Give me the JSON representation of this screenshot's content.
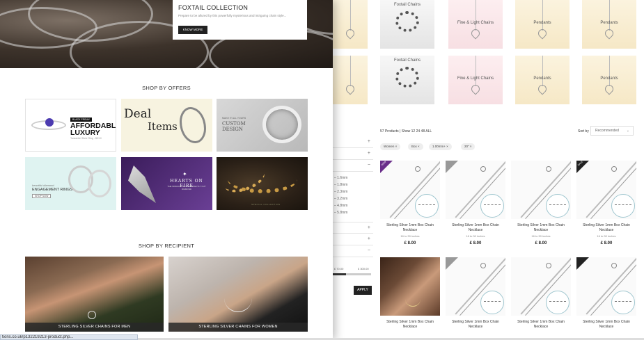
{
  "hero": {
    "title": "FOXTAIL COLLECTION",
    "description": "Prepare to be allured by this powerfully mysterious and intriguing chain style...",
    "button": "KNOW MORE"
  },
  "offers": {
    "title": "SHOP BY OFFERS",
    "tiles": {
      "luxury": {
        "badge": "BLACK FRIDAY",
        "headline": "AFFORDABLE LUXURY",
        "sub": "Tanzanite Silver Ring - $XXX"
      },
      "deal": {
        "line1": "Deal",
        "line2": "Items"
      },
      "custom": {
        "small": "MAKE IT ALL YOURS",
        "headline": "CUSTOM DESIGN"
      },
      "engagement": {
        "script": "beautiful diamond",
        "headline": "ENGAGEMENT RINGS",
        "button": "SHOP NOW"
      },
      "hof": {
        "brand": "HEARTS ON FIRE",
        "sub": "THE WORLD'S MOST PERFECTLY CUT DIAMOND"
      },
      "gold": {
        "tag": "SPECIAL COLLECTION"
      }
    }
  },
  "recipient": {
    "title": "SHOP BY RECIPIENT",
    "men": "STERLING SILVER CHAINS FOR MEN",
    "women": "STERLING SILVER CHAINS FOR WOMEN"
  },
  "categories": {
    "row1": [
      "Foxtail Chains",
      "Fine & Light Chains",
      "Pendants",
      "Pendants"
    ],
    "row2": [
      "Foxtail Chains",
      "Fine & Light Chains",
      "Pendants",
      "Pendants"
    ]
  },
  "filters": {
    "sizes": [
      "1.6mm",
      "1.8mm",
      "2.3mm",
      "3.2mm",
      "4.8mm",
      "5.8mm"
    ],
    "price_min": "£ 70.00",
    "price_max": "£ 300.00",
    "price_fill_fraction": 0.35,
    "apply": "APPLY"
  },
  "products": {
    "summary": "57 Products | Show  12  24  48  ALL",
    "sort_label": "Sort by",
    "sort_value": "Recommended",
    "chips": [
      "Women ×",
      "Box ×",
      "1.00mm+ ×",
      "20\" ×"
    ],
    "items": [
      {
        "name": "Sterling Silver 1mm Box Chain Necklace",
        "sub": "16 to 30 inches",
        "price": "£ 8.00",
        "badge": "NEW"
      },
      {
        "name": "Sterling Silver 1mm Box Chain Necklace",
        "sub": "16 to 30 inches",
        "price": "£ 8.00",
        "badge": ""
      },
      {
        "name": "Sterling Silver 1mm Box Chain Necklace",
        "sub": "16 to 30 inches",
        "price": "£ 8.00",
        "badge": ""
      },
      {
        "name": "Sterling Silver 1mm Box Chain Necklace",
        "sub": "16 to 30 inches",
        "price": "£ 8.00",
        "badge": "SALE"
      },
      {
        "name": "Sterling Silver 1mm Box Chain Necklace",
        "sub": "",
        "price": "",
        "badge": ""
      },
      {
        "name": "Sterling Silver 1mm Box Chain Necklace",
        "sub": "",
        "price": "",
        "badge": ""
      },
      {
        "name": "Sterling Silver 1mm Box Chain Necklace",
        "sub": "",
        "price": "",
        "badge": ""
      },
      {
        "name": "Sterling Silver 1mm Box Chain Necklace",
        "sub": "",
        "price": "",
        "badge": ""
      }
    ]
  },
  "status": {
    "url": "tions.co.uk/p132219213-product.php..."
  },
  "colors": {
    "accent_purple": "#6a2e8a",
    "badge_dark": "#222222",
    "tile_cream": "#f6e8c6"
  }
}
